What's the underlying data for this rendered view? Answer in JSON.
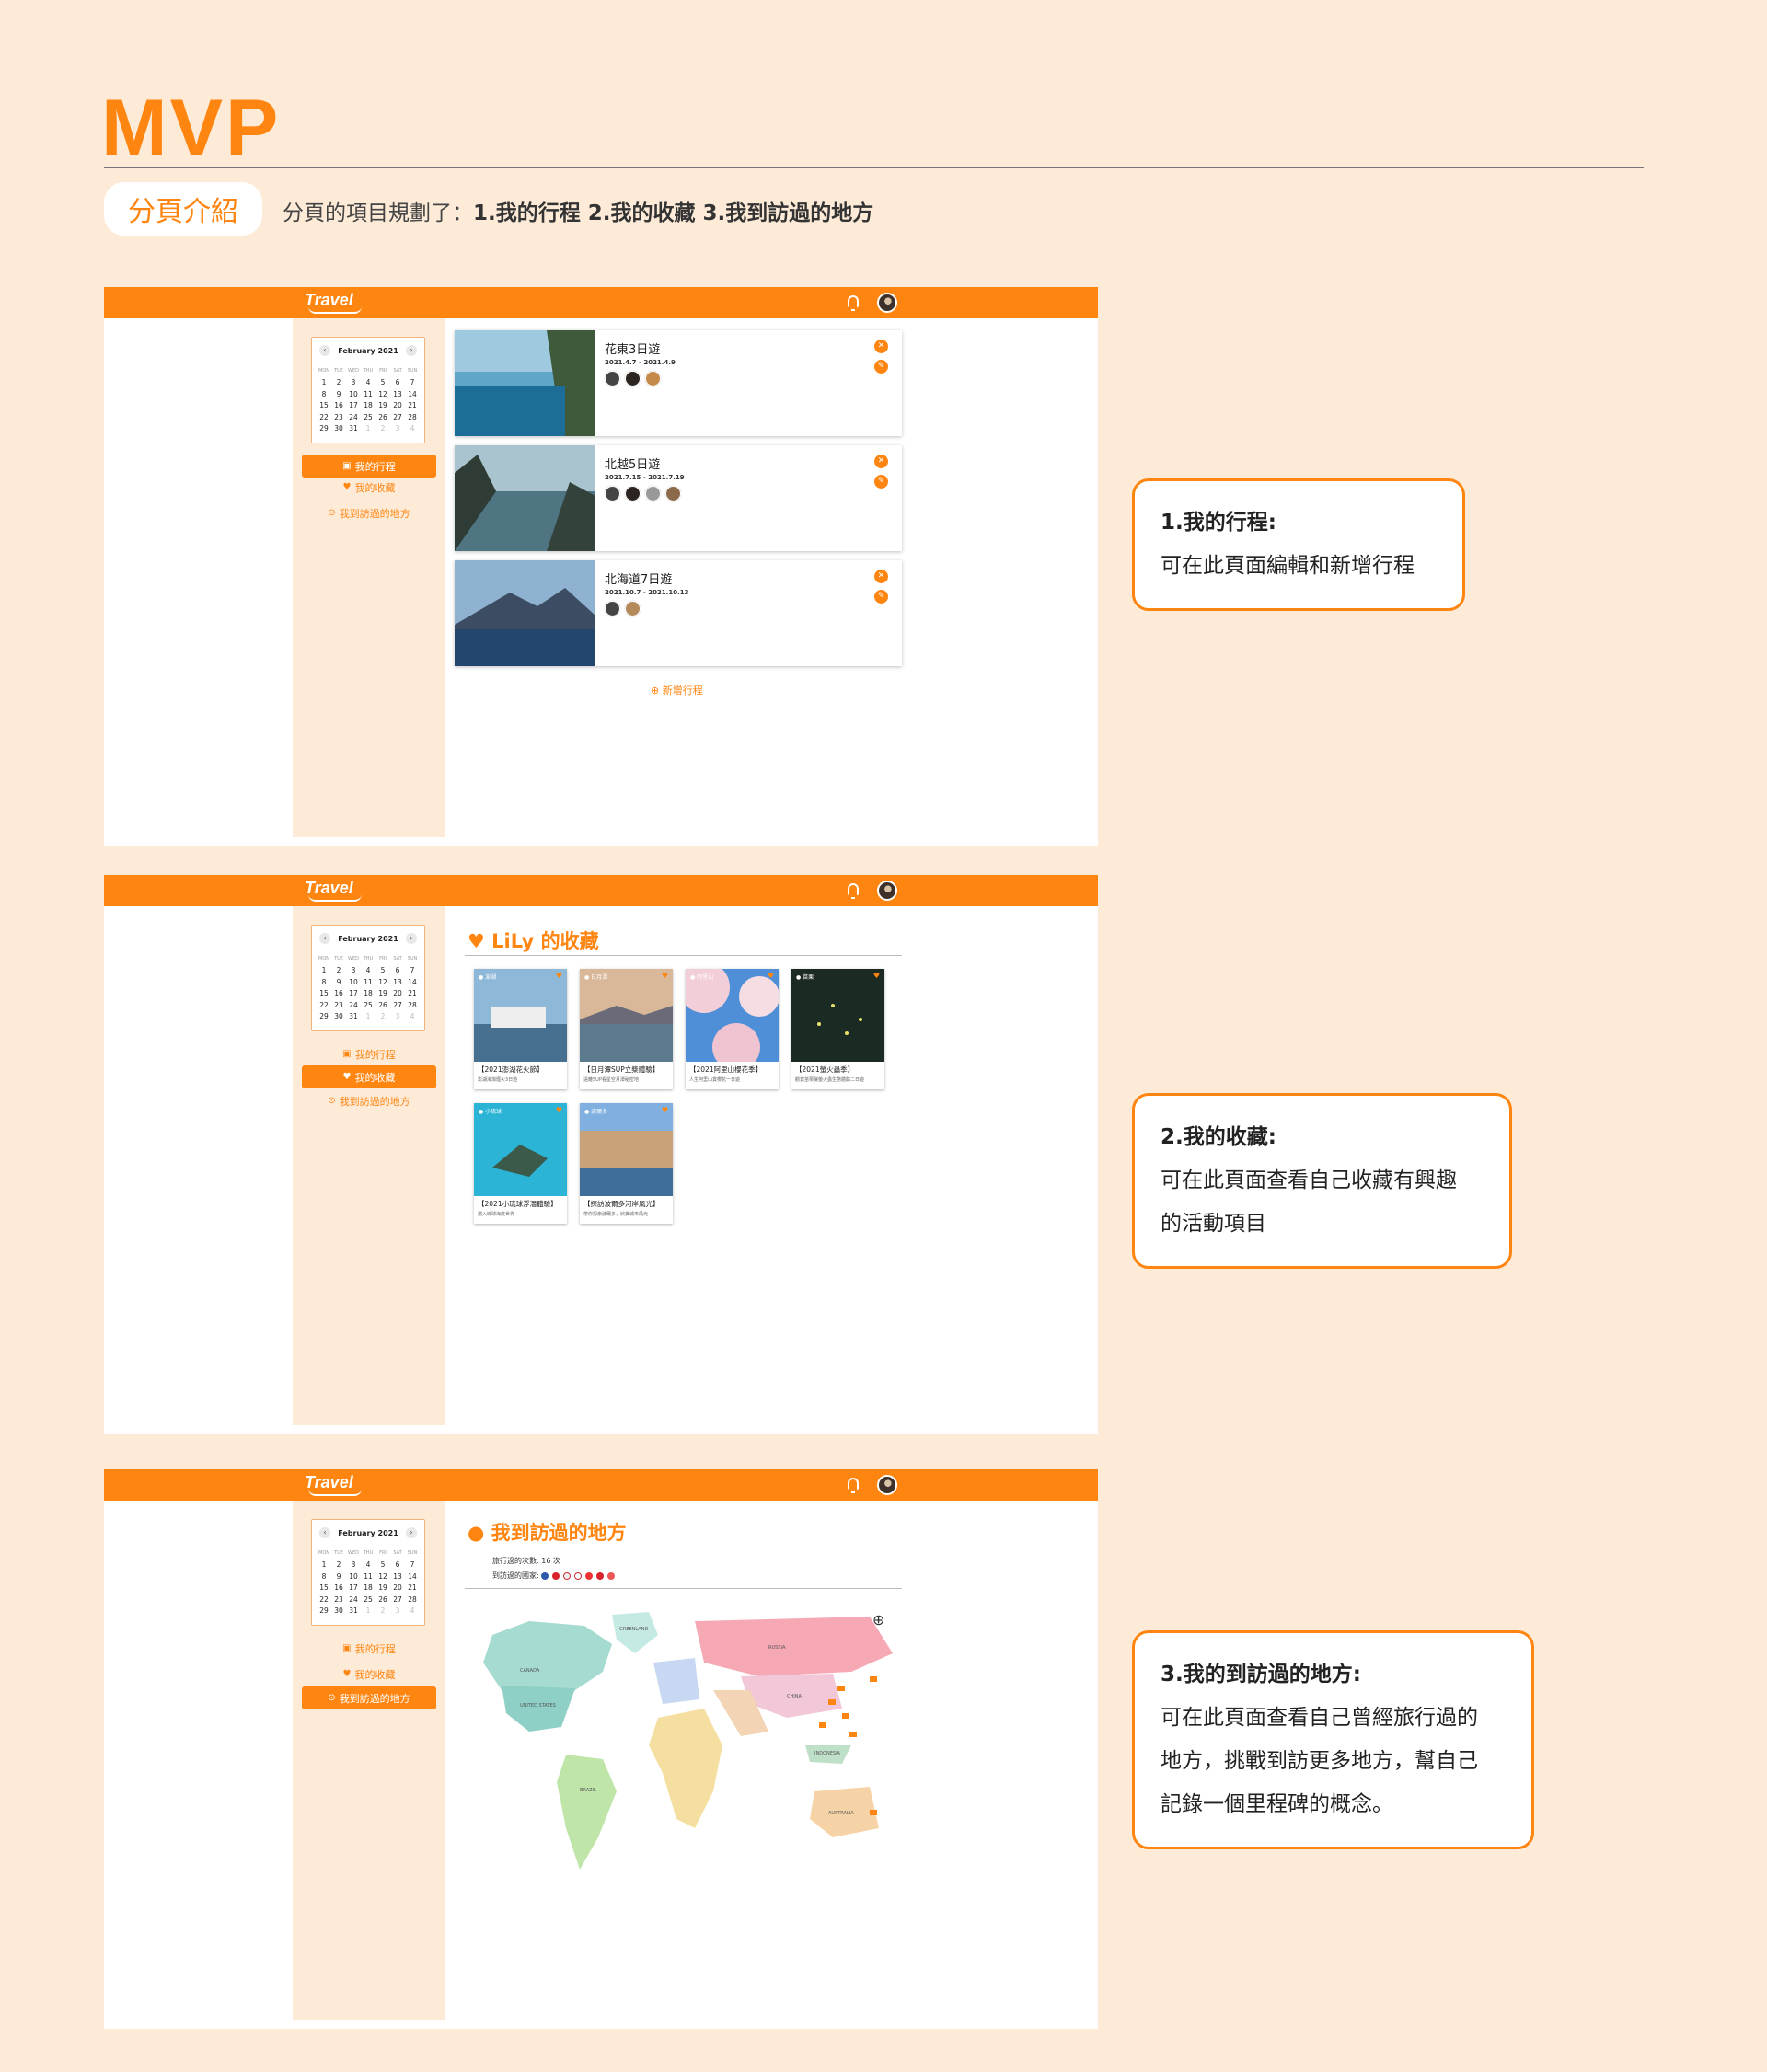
{
  "header": {
    "title": "MVP",
    "pill": "分頁介紹",
    "intro_prefix": "分頁的項目規劃了：",
    "intro_bold": "1.我的行程 2.我的收藏 3.我到訪過的地方"
  },
  "app": {
    "logo": "Travel",
    "calendar": {
      "month": "February 2021",
      "weekdays": [
        "MON",
        "TUE",
        "WED",
        "THU",
        "FRI",
        "SAT",
        "SUN"
      ],
      "days": [
        "1",
        "2",
        "3",
        "4",
        "5",
        "6",
        "7",
        "8",
        "9",
        "10",
        "11",
        "12",
        "13",
        "14",
        "15",
        "16",
        "17",
        "18",
        "19",
        "20",
        "21",
        "22",
        "23",
        "24",
        "25",
        "26",
        "27",
        "28",
        "29",
        "30",
        "31",
        "1",
        "2",
        "3",
        "4"
      ]
    },
    "nav": {
      "trips": "我的行程",
      "favorites": "我的收藏",
      "places": "我到訪過的地方"
    }
  },
  "trips": [
    {
      "title": "花東3日遊",
      "dates": "2021.4.7 - 2021.4.9"
    },
    {
      "title": "北越5日遊",
      "dates": "2021.7.15 - 2021.7.19"
    },
    {
      "title": "北海道7日遊",
      "dates": "2021.10.7 - 2021.10.13"
    }
  ],
  "add_trip": "新增行程",
  "favorites": {
    "heading": "LiLy 的收藏",
    "items": [
      {
        "loc": "澎湖",
        "title": "【2021澎湖花火節】",
        "sub": "澎湖海灣煙火3日遊"
      },
      {
        "loc": "日月潭",
        "title": "【日月潭SUP立槳體驗】",
        "sub": "遠離SUP看星空月潭秘密地"
      },
      {
        "loc": "阿里山",
        "title": "【2021阿里山櫻花季】",
        "sub": "人生阿里山賞櫻花一日遊"
      },
      {
        "loc": "苗栗",
        "title": "【2021螢火蟲季】",
        "sub": "觀賞苗栗縣螢火蟲生態體驗二日遊"
      },
      {
        "loc": "小琉球",
        "title": "【2021小琉球浮潛體驗】",
        "sub": "潛入琉球海底世界"
      },
      {
        "loc": "波爾多",
        "title": "【探訪波爾多河岸風光】",
        "sub": "帶你探索波爾多，欣賞城市風光"
      }
    ]
  },
  "places": {
    "heading": "我到訪過的地方",
    "count_line": "旅行過的次數: 16 次",
    "countries_label": "到訪過的國家:",
    "map_labels": [
      "RUSSIA",
      "CANADA",
      "UNITED STATES",
      "CHINA",
      "BRAZIL",
      "AUSTRALIA",
      "INDONESIA",
      "GREENLAND"
    ]
  },
  "callouts": [
    {
      "head": "1.我的行程:",
      "lines": [
        "可在此頁面編輯和新增行程"
      ]
    },
    {
      "head": "2.我的收藏:",
      "lines": [
        "可在此頁面查看自己收藏有興趣",
        "的活動項目"
      ]
    },
    {
      "head": "3.我的到訪過的地方:",
      "lines": [
        "可在此頁面查看自己曾經旅行過的",
        "地方，挑戰到訪更多地方，幫自己",
        "記錄一個里程碑的概念。"
      ]
    }
  ],
  "colors": {
    "accent": "#ff8511",
    "background": "#fdebd8"
  }
}
